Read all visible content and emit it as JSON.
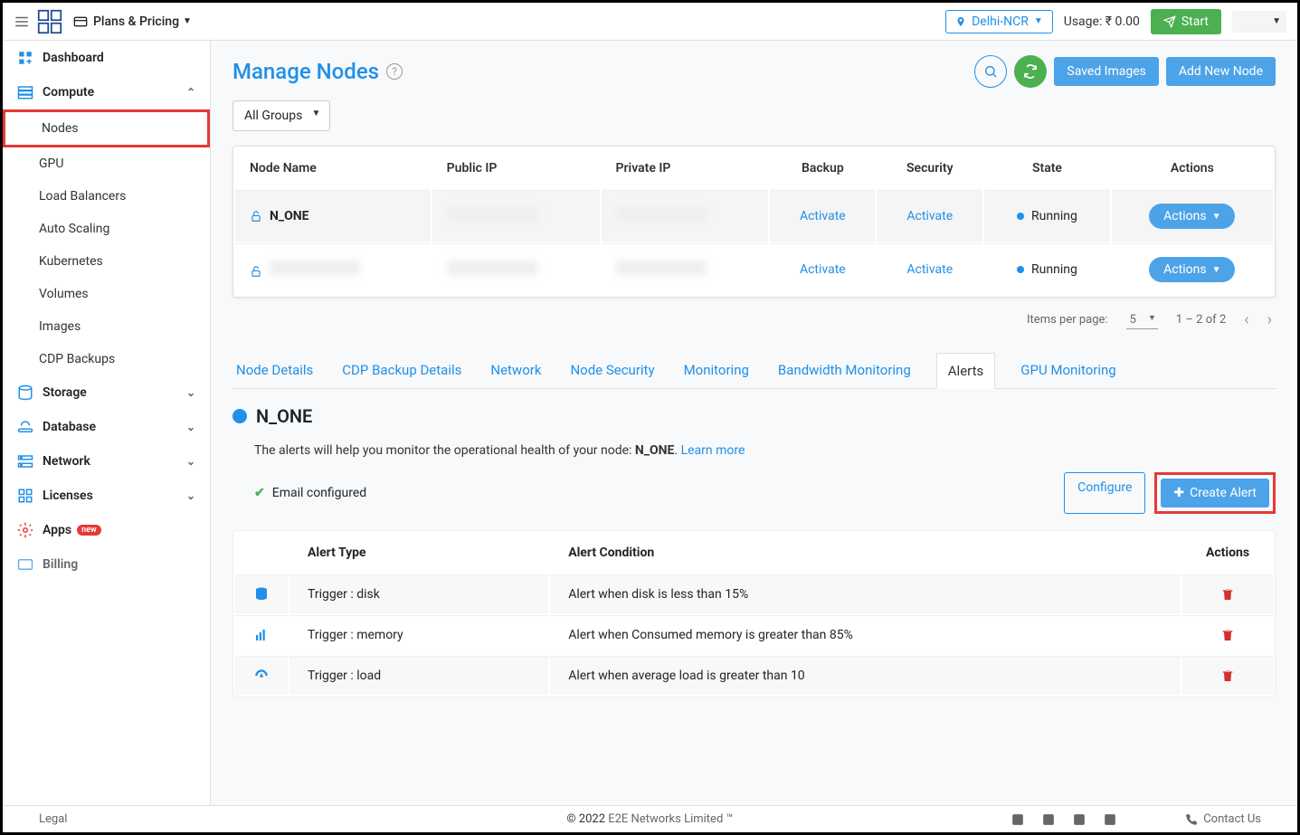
{
  "topbar": {
    "plans_label": "Plans & Pricing",
    "region": "Delhi-NCR",
    "usage_label": "Usage: ₹ 0.00",
    "start_label": "Start"
  },
  "sidebar": {
    "dashboard": "Dashboard",
    "compute": "Compute",
    "compute_items": [
      "Nodes",
      "GPU",
      "Load Balancers",
      "Auto Scaling",
      "Kubernetes",
      "Volumes",
      "Images",
      "CDP Backups"
    ],
    "storage": "Storage",
    "database": "Database",
    "network": "Network",
    "licenses": "Licenses",
    "apps": "Apps",
    "apps_badge": "new",
    "billing": "Billing"
  },
  "page": {
    "title": "Manage Nodes",
    "saved_images": "Saved Images",
    "add_new_node": "Add New Node",
    "group_filter": "All Groups"
  },
  "table": {
    "headers": [
      "Node Name",
      "Public IP",
      "Private IP",
      "Backup",
      "Security",
      "State",
      "Actions"
    ],
    "rows": [
      {
        "name": "N_ONE",
        "backup": "Activate",
        "security": "Activate",
        "state": "Running",
        "actions": "Actions"
      },
      {
        "name": "",
        "backup": "Activate",
        "security": "Activate",
        "state": "Running",
        "actions": "Actions"
      }
    ],
    "items_per_page_label": "Items per page:",
    "items_per_page_value": "5",
    "range": "1 – 2 of 2"
  },
  "tabs": [
    "Node Details",
    "CDP Backup Details",
    "Network",
    "Node Security",
    "Monitoring",
    "Bandwidth Monitoring",
    "Alerts",
    "GPU Monitoring"
  ],
  "active_tab": "Alerts",
  "selected_node": "N_ONE",
  "alerts": {
    "desc_pre": "The alerts will help you monitor the operational health of your node: ",
    "desc_node": "N_ONE",
    "desc_post": ". ",
    "learn_more": "Learn more",
    "email_configured": "Email configured",
    "configure": "Configure",
    "create_alert": "Create Alert",
    "headers": [
      "Alert Type",
      "Alert Condition",
      "Actions"
    ],
    "rows": [
      {
        "icon": "disk",
        "type": "Trigger : disk",
        "condition": "Alert when disk is less than 15%"
      },
      {
        "icon": "memory",
        "type": "Trigger : memory",
        "condition": "Alert when Consumed memory is greater than 85%"
      },
      {
        "icon": "load",
        "type": "Trigger : load",
        "condition": "Alert when average load is greater than 10"
      }
    ]
  },
  "footer": {
    "legal": "Legal",
    "copyright": "© 2022 ",
    "company": "E2E Networks Limited ™",
    "contact": "Contact Us"
  }
}
